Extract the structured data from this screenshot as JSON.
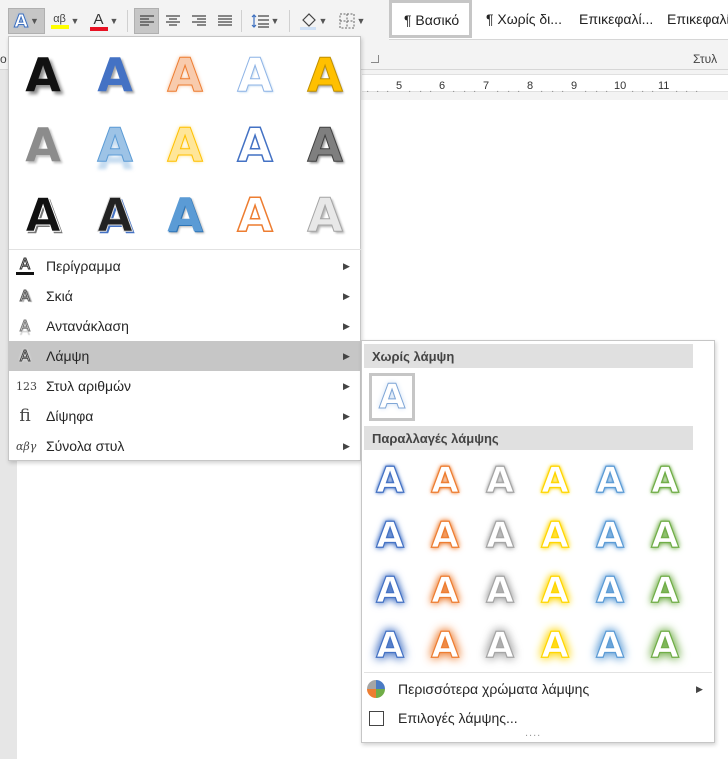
{
  "ribbon": {
    "styles": {
      "items": [
        "¶ Βασικό",
        "¶ Χωρίς δι...",
        "Επικεφαλί...",
        "Επικεφαλί"
      ],
      "group_label": "Στυλ"
    },
    "icons": {
      "text_effects": "text-effects-icon",
      "highlight": "highlight-icon",
      "highlight_color": "#ffff00",
      "font_color": "font-color-icon",
      "font_color_value": "#e81123",
      "highlight_glyph": "αβ"
    }
  },
  "ruler": {
    "numbers": [
      "5",
      "6",
      "7",
      "8",
      "9",
      "10",
      "11"
    ]
  },
  "menu": {
    "items": [
      {
        "label": "Περίγραμμα",
        "icon": "outline-icon",
        "glyph": "A",
        "has_submenu": true
      },
      {
        "label": "Σκιά",
        "icon": "shadow-icon",
        "glyph": "A",
        "has_submenu": true
      },
      {
        "label": "Αντανάκλαση",
        "icon": "reflection-icon",
        "glyph": "A",
        "has_submenu": true
      },
      {
        "label": "Λάμψη",
        "icon": "glow-icon",
        "glyph": "A",
        "has_submenu": true,
        "active": true
      },
      {
        "label": "Στυλ αριθμών",
        "icon": "number-styles-icon",
        "glyph": "123",
        "has_submenu": true
      },
      {
        "label": "Δίψηφα",
        "icon": "ligatures-icon",
        "glyph": "fi",
        "has_submenu": true
      },
      {
        "label": "Σύνολα στυλ",
        "icon": "stylistic-sets-icon",
        "glyph": "αβγ",
        "has_submenu": true
      }
    ],
    "arrow": "▶",
    "effect_glyph": "A"
  },
  "glow_submenu": {
    "no_glow_header": "Χωρίς λάμψη",
    "variations_header": "Παραλλαγές λάμψης",
    "glyph": "A",
    "glow_colors": [
      "#4472c4",
      "#ed7d31",
      "#a5a5a5",
      "#ffd600",
      "#5b9bd5",
      "#70ad47"
    ],
    "more_colors_label": "Περισσότερα χρώματα λάμψης",
    "options_label": "Επιλογές λάμψης...",
    "grip": "....",
    "arrow": "▶"
  }
}
